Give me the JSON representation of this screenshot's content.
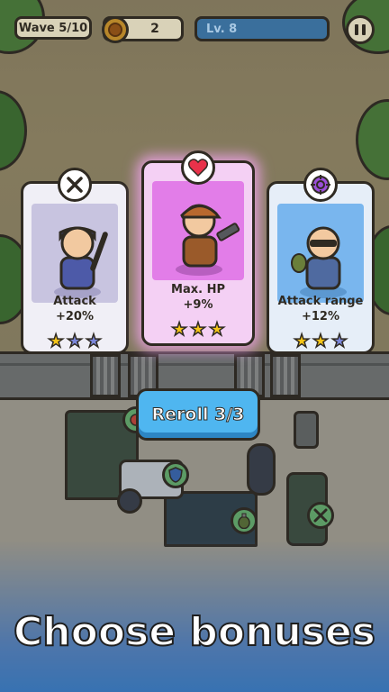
{
  "hud": {
    "wave": "Wave 5/10",
    "coins": "2",
    "level": "Lv. 8"
  },
  "icons": {
    "pause": "pause-icon",
    "coin": "coin-icon",
    "attack": "crossed-swords-icon",
    "hp": "heart-icon",
    "range": "crosshair-icon"
  },
  "cards": [
    {
      "title": "Attack",
      "value": "+20%",
      "stars_filled": 1,
      "stars_total": 3,
      "theme": "#c8c4e0"
    },
    {
      "title": "Max. HP",
      "value": "+9%",
      "stars_filled": 3,
      "stars_total": 3,
      "theme": "#e27de8"
    },
    {
      "title": "Attack range",
      "value": "+12%",
      "stars_filled": 2,
      "stars_total": 3,
      "theme": "#79b6ee"
    }
  ],
  "reroll_label": "Reroll 3/3",
  "caption": "Choose bonuses",
  "colors": {
    "star_filled": "#f5c518",
    "star_empty": "#7a86d9",
    "reroll": "#4fb6f0"
  }
}
